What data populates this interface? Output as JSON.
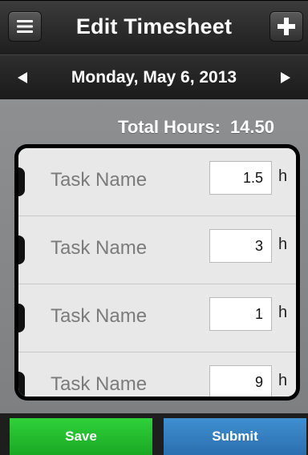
{
  "header": {
    "title": "Edit Timesheet",
    "menu_icon": "menu-icon",
    "add_icon": "plus-icon"
  },
  "date_bar": {
    "date": "Monday, May 6, 2013",
    "prev_icon": "triangle-left-icon",
    "next_icon": "triangle-right-icon"
  },
  "total": {
    "label": "Total Hours:",
    "value": "14.50"
  },
  "tasks": [
    {
      "name": "Task Name",
      "hours": "1.5",
      "unit": "h"
    },
    {
      "name": "Task Name",
      "hours": "3",
      "unit": "h"
    },
    {
      "name": "Task Name",
      "hours": "1",
      "unit": "h"
    },
    {
      "name": "Task Name",
      "hours": "9",
      "unit": "h"
    }
  ],
  "footer": {
    "save_label": "Save",
    "submit_label": "Submit"
  },
  "colors": {
    "save": "#22c02d",
    "submit": "#3580c2",
    "header": "#2a2a2a"
  }
}
